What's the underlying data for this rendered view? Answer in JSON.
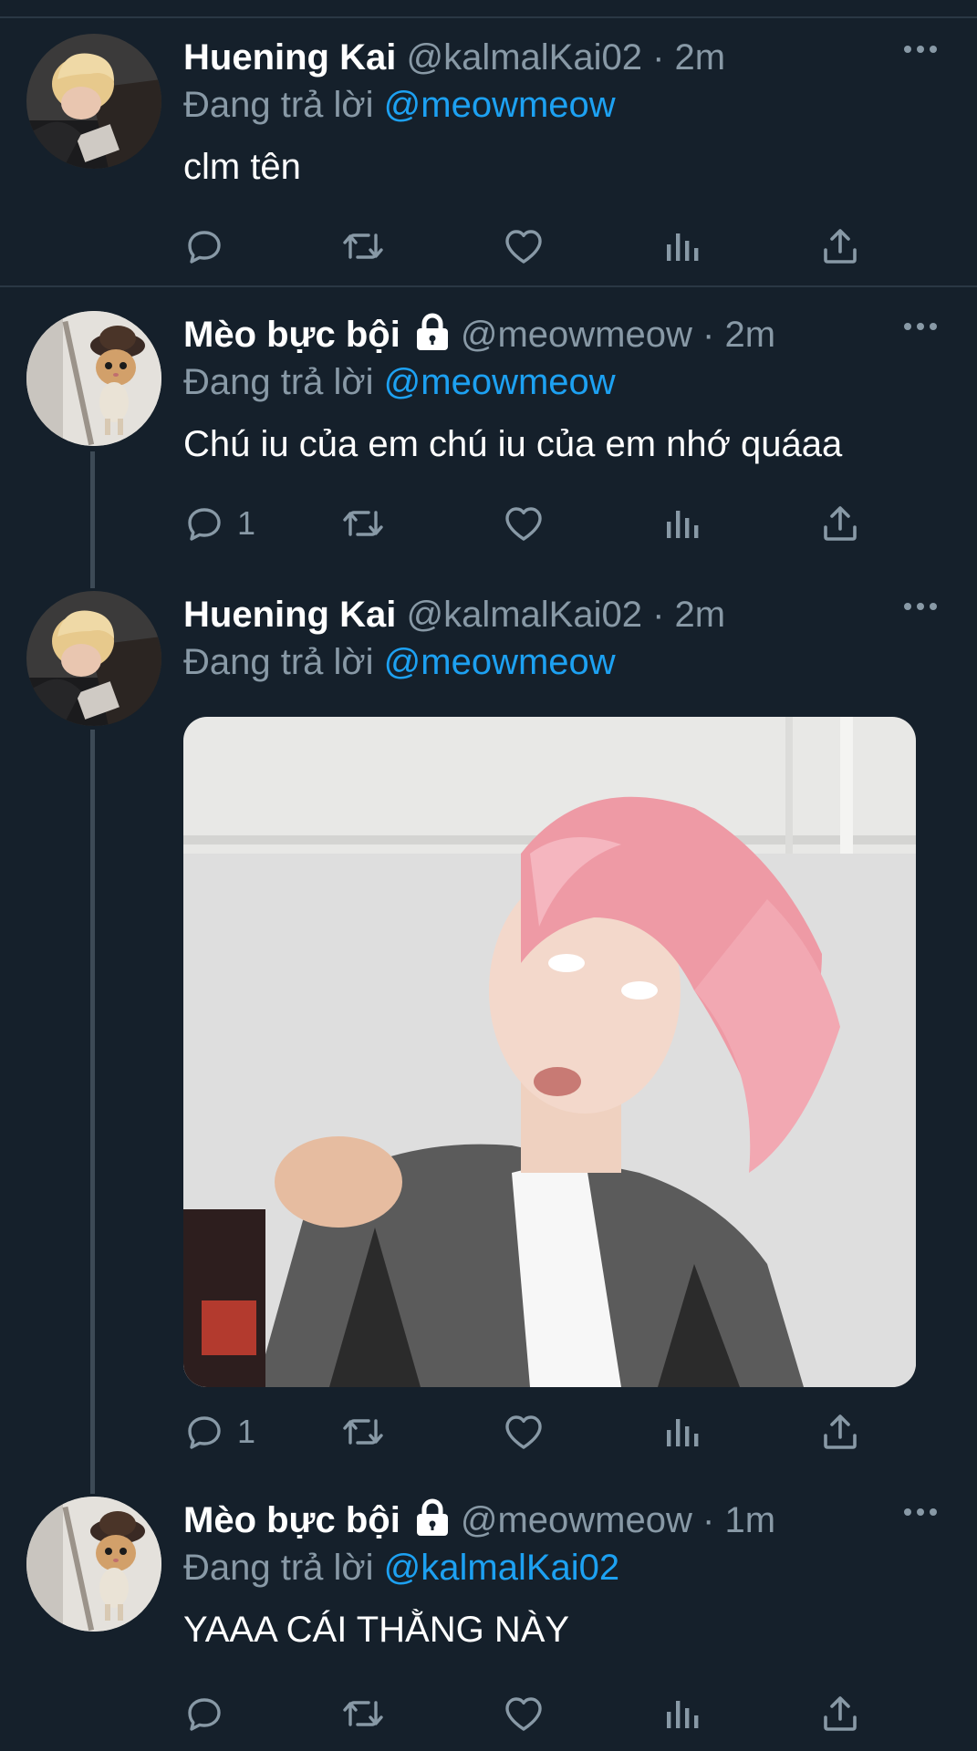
{
  "reply_prefix": "Đang trả lời",
  "dot": "·",
  "tweets": [
    {
      "name": "Huening Kai",
      "handle": "@kalmalKai02",
      "time": "2m",
      "reply_to": "@meowmeow",
      "text": "clm tên",
      "reply_count": "",
      "locked": false,
      "avatar": "boy-avatar"
    },
    {
      "name": "Mèo bực bội",
      "handle": "@meowmeow",
      "time": "2m",
      "reply_to": "@meowmeow",
      "text": "Chú iu của em chú iu của em nhớ quáaa",
      "reply_count": "1",
      "locked": true,
      "avatar": "cat-avatar"
    },
    {
      "name": "Huening Kai",
      "handle": "@kalmalKai02",
      "time": "2m",
      "reply_to": "@meowmeow",
      "text": "",
      "reply_count": "1",
      "locked": false,
      "avatar": "boy-avatar",
      "media": "photo of person with pink hair"
    },
    {
      "name": "Mèo bực bội",
      "handle": "@meowmeow",
      "time": "1m",
      "reply_to": "@kalmalKai02",
      "text": "YAAA CÁI THẰNG NÀY",
      "reply_count": "",
      "locked": true,
      "avatar": "cat-avatar"
    }
  ],
  "icons": [
    "reply-icon",
    "retweet-icon",
    "like-icon",
    "analytics-icon",
    "share-icon",
    "more-icon",
    "lock-icon"
  ],
  "colors": {
    "background": "#15202b",
    "secondary_text": "#8899a6",
    "accent": "#1da1f2",
    "divider": "#2a3744"
  }
}
